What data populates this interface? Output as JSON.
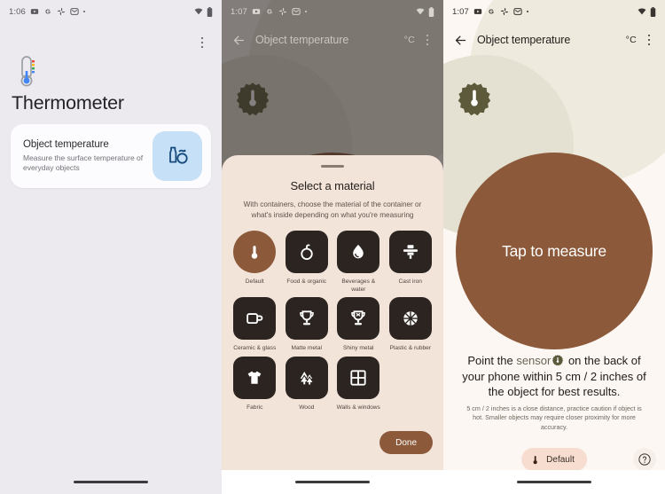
{
  "panel1": {
    "statusbar": {
      "time": "1:06",
      "icons": [
        "youtube-icon",
        "google-icon",
        "photos-icon",
        "messages-icon",
        "dot-icon"
      ],
      "right_icons": [
        "wifi-icon",
        "battery-icon"
      ]
    },
    "overflow_menu": "more-options",
    "app_icon": "thermometer-icon",
    "title": "Thermometer",
    "card": {
      "title": "Object temperature",
      "subtitle": "Measure the surface temperature of everyday objects",
      "icon": "object-temperature-icon"
    },
    "nav_pill": "home-indicator"
  },
  "panel2": {
    "statusbar": {
      "time": "1:07",
      "icons": [
        "youtube-icon",
        "google-icon",
        "photos-icon",
        "messages-icon",
        "dot-icon"
      ],
      "right_icons": [
        "wifi-icon",
        "battery-icon"
      ]
    },
    "appbar": {
      "back": "back-arrow",
      "title": "Object temperature",
      "unit": "°C",
      "overflow": "more-options"
    },
    "sheet": {
      "title": "Select a material",
      "subtitle": "With containers, choose the material of the container or what's inside depending on what you're measuring",
      "done_label": "Done",
      "materials": [
        {
          "label": "Default",
          "icon": "thermometer-icon",
          "selected": true
        },
        {
          "label": "Food & organic",
          "icon": "food-organic-icon",
          "selected": false
        },
        {
          "label": "Beverages & water",
          "icon": "water-drop-icon",
          "selected": false
        },
        {
          "label": "Cast iron",
          "icon": "cast-iron-pan-icon",
          "selected": false
        },
        {
          "label": "Ceramic & glass",
          "icon": "mug-icon",
          "selected": false
        },
        {
          "label": "Matte metal",
          "icon": "trophy-matte-icon",
          "selected": false
        },
        {
          "label": "Shiny metal",
          "icon": "trophy-shiny-icon",
          "selected": false
        },
        {
          "label": "Plastic & rubber",
          "icon": "ball-icon",
          "selected": false
        },
        {
          "label": "Fabric",
          "icon": "tshirt-icon",
          "selected": false
        },
        {
          "label": "Wood",
          "icon": "trees-icon",
          "selected": false
        },
        {
          "label": "Walls & windows",
          "icon": "window-grid-icon",
          "selected": false
        }
      ]
    },
    "nav_pill": "home-indicator"
  },
  "panel3": {
    "statusbar": {
      "time": "1:07",
      "icons": [
        "youtube-icon",
        "google-icon",
        "photos-icon",
        "messages-icon",
        "dot-icon"
      ],
      "right_icons": [
        "wifi-icon",
        "battery-icon"
      ]
    },
    "appbar": {
      "back": "back-arrow",
      "title": "Object temperature",
      "unit": "°C",
      "overflow": "more-options"
    },
    "sensor_badge": "sensor-location-badge",
    "measure_button": "Tap to measure",
    "hint": {
      "part1": "Point the ",
      "sensor_word": "sensor",
      "part2": " on the back of your phone within 5 cm / 2 inches of the object for best results."
    },
    "fine_print": "5 cm / 2 inches is a close distance, practice caution if object is hot. Smaller objects may require closer proximity for more accuracy.",
    "material_chip": "Default",
    "help_button": "help-icon",
    "nav_pill": "home-indicator"
  },
  "colors": {
    "panel1_bg": "#eceaef",
    "measure_bg": "#fdf7f4",
    "sheet_bg": "#f3e4da",
    "brown_accent": "#8c5a3a",
    "tile_dark": "#2b2420",
    "badge_olive": "#5c5a3a",
    "card_icon_bg": "#c5e0f7",
    "chip_bg": "#f6ddd0"
  }
}
